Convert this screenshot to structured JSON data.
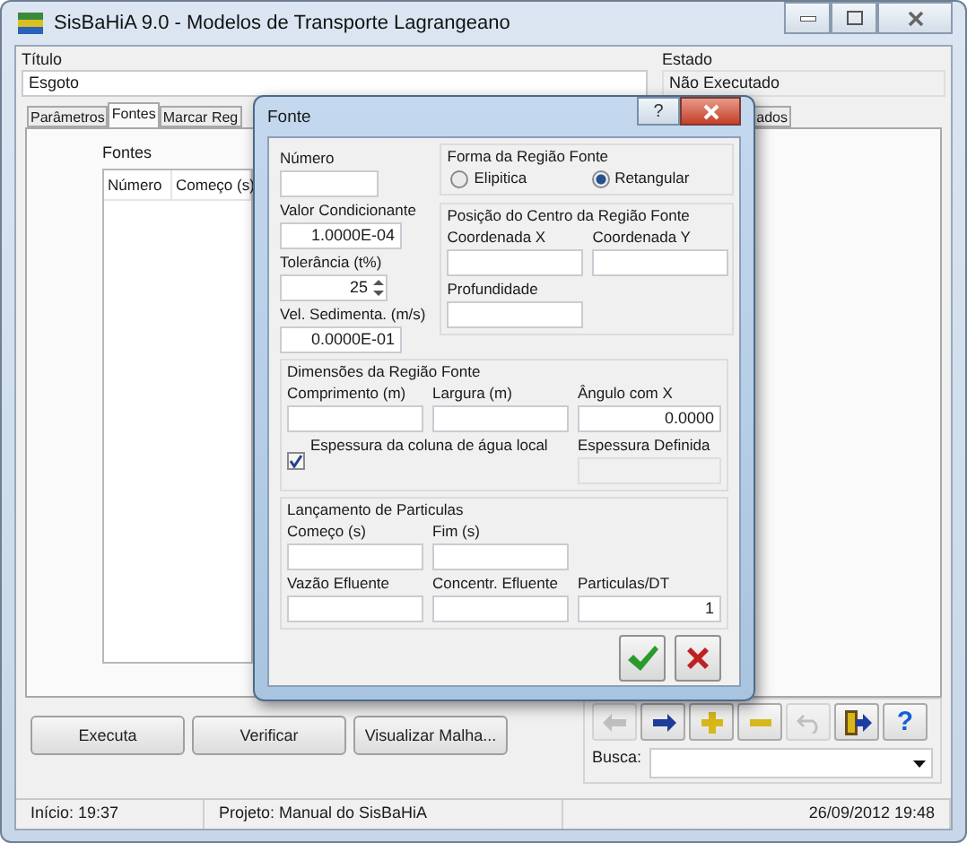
{
  "window": {
    "title": "SisBaHiA 9.0 - Modelos de Transporte Lagrangeano"
  },
  "header": {
    "title_label": "Título",
    "title_value": "Esgoto",
    "state_label": "Estado",
    "state_value": "Não Executado"
  },
  "tabs": [
    {
      "label": "Parâmetros",
      "selected": false
    },
    {
      "label": "Fontes",
      "selected": true
    },
    {
      "label": "Marcar Reg",
      "selected": false
    },
    {
      "label": "ados",
      "selected": false
    }
  ],
  "sources": {
    "label": "Fontes",
    "columns": [
      "Número",
      "Começo (s)"
    ]
  },
  "buttons": [
    "Executa",
    "Verificar",
    "Visualizar Malha..."
  ],
  "toolbar": [
    {
      "kind": "back",
      "disabled": true
    },
    {
      "kind": "forward",
      "disabled": false
    },
    {
      "kind": "add",
      "disabled": false
    },
    {
      "kind": "remove",
      "disabled": false
    },
    {
      "kind": "undo",
      "disabled": true
    },
    {
      "kind": "exit",
      "disabled": false
    },
    {
      "kind": "help",
      "label": "?",
      "disabled": false
    }
  ],
  "search": {
    "label": "Busca:"
  },
  "status_bar": [
    "Início: 19:37",
    "Projeto: Manual do SisBaHiA",
    "26/09/2012 19:48"
  ],
  "dialog": {
    "title": "Fonte",
    "help": "?",
    "left_fields": [
      {
        "kind": "text",
        "label": "Número"
      },
      {
        "kind": "text",
        "label": "Valor Condicionante",
        "value": "1.0000E-04"
      },
      {
        "kind": "spin",
        "label": "Tolerância (t%)",
        "value": "25"
      },
      {
        "kind": "text",
        "label": "Vel. Sedimenta. (m/s)",
        "value": "0.0000E-01"
      }
    ],
    "shape": {
      "title": "Forma da Região Fonte",
      "options": [
        {
          "label": "Elipitica",
          "selected": false
        },
        {
          "label": "Retangular",
          "selected": true
        }
      ]
    },
    "center": {
      "title": "Posição do Centro da Região Fonte",
      "fields": [
        {
          "label": "Coordenada X"
        },
        {
          "label": "Coordenada Y"
        },
        {
          "label": "Profundidade"
        }
      ]
    },
    "dimensions": {
      "title": "Dimensões da Região Fonte",
      "fields": [
        {
          "label": "Comprimento (m)"
        },
        {
          "label": "Largura (m)"
        },
        {
          "label": "Ângulo com X",
          "value": "0.0000"
        }
      ],
      "local_thickness": {
        "label": "Espessura da coluna de água local",
        "checked": true
      },
      "defined_thickness": {
        "label": "Espessura Definida",
        "disabled": true
      }
    },
    "release": {
      "title": "Lançamento de Particulas",
      "fields": [
        {
          "label": "Começo (s)"
        },
        {
          "label": "Fim (s)"
        },
        {
          "label": "Vazão Efluente"
        },
        {
          "label": "Concentr. Efluente"
        },
        {
          "label": "Particulas/DT",
          "value": "1"
        }
      ]
    }
  }
}
